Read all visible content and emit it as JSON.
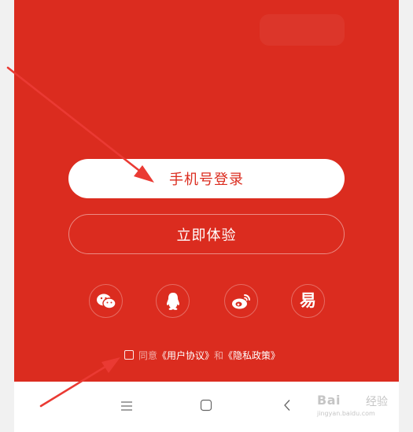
{
  "login": {
    "phone_login_label": "手机号登录",
    "try_now_label": "立即体验"
  },
  "social_logins": [
    {
      "icon": "wechat-icon"
    },
    {
      "icon": "qq-icon"
    },
    {
      "icon": "weibo-icon"
    },
    {
      "icon": "netease-yi-icon",
      "glyph": "易"
    }
  ],
  "agreement": {
    "agree_text": "同意",
    "user_agreement": "《用户协议》",
    "and_text": "和",
    "privacy_policy": "《隐私政策》",
    "checked": false
  },
  "watermark": {
    "brand": "Bai",
    "brand_suffix": "经验",
    "url": "jingyan.baidu.com"
  },
  "colors": {
    "primary_red": "#db2c1f",
    "annotation_red": "#ea3a33",
    "navbar_icon": "#666666"
  }
}
